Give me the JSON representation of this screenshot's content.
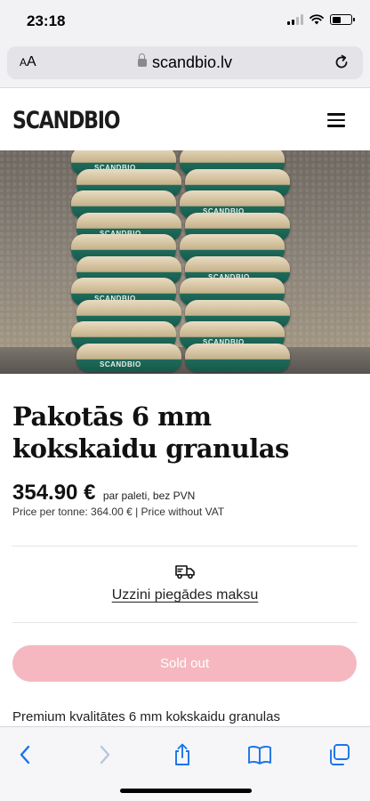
{
  "status_bar": {
    "time": "23:18"
  },
  "browser": {
    "aa_label_small": "A",
    "aa_label_large": "A",
    "url": "scandbio.lv"
  },
  "site": {
    "logo": "SCANDBIO"
  },
  "hero": {
    "bag_brand": "SCANDBIO"
  },
  "product": {
    "title": "Pakotās 6 mm kokskaidu granulas",
    "price": "354.90 €",
    "price_note": "par paleti, bez PVN",
    "price_sub": "Price per tonne: 364.00 € | Price without VAT",
    "delivery_link": "Uzzini piegādes maksu",
    "sold_out_label": "Sold out",
    "description_start": "Premium kvalitātes 6 mm kokskaidu granulas"
  },
  "colors": {
    "sold_out_bg": "#f5b8c0",
    "ios_blue": "#1a73e8"
  }
}
